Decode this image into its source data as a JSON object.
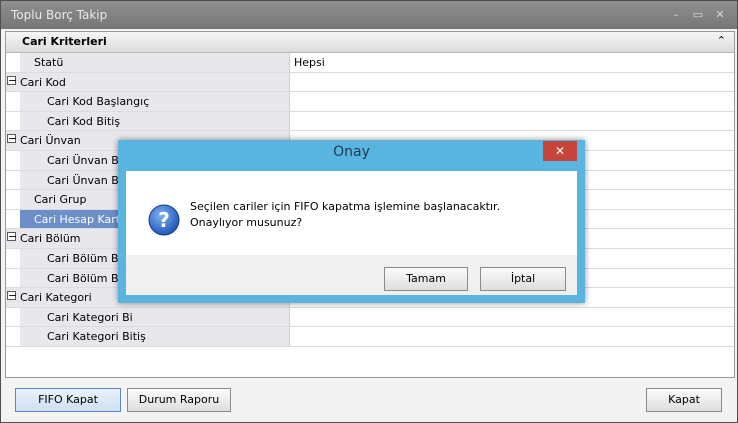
{
  "window": {
    "title": "Toplu Borç Takip",
    "controls": [
      "–",
      "▭",
      "✕"
    ]
  },
  "panel": {
    "title": "Cari Kriterleri",
    "collapse_icon": "chevron-double-up-icon"
  },
  "grid": {
    "rows": [
      {
        "label": "Statü",
        "value": "Hepsi",
        "kind": "item"
      },
      {
        "label": "Cari Kod",
        "value": "",
        "kind": "category"
      },
      {
        "label": "Cari Kod Başlangıç",
        "value": "",
        "kind": "sub"
      },
      {
        "label": "Cari Kod Bitiş",
        "value": "",
        "kind": "sub"
      },
      {
        "label": "Cari Ünvan",
        "value": "",
        "kind": "category"
      },
      {
        "label": "Cari Ünvan Baş",
        "value": "",
        "kind": "sub"
      },
      {
        "label": "Cari Ünvan Bitiş",
        "value": "",
        "kind": "sub"
      },
      {
        "label": "Cari Grup",
        "value": "",
        "kind": "item"
      },
      {
        "label": "Cari Hesap Kart T",
        "value": "",
        "kind": "item",
        "selected": true
      },
      {
        "label": "Cari Bölüm",
        "value": "",
        "kind": "category"
      },
      {
        "label": "Cari Bölüm Başl",
        "value": "",
        "kind": "sub"
      },
      {
        "label": "Cari Bölüm Bitiş",
        "value": "",
        "kind": "sub"
      },
      {
        "label": "Cari Kategori",
        "value": "",
        "kind": "category"
      },
      {
        "label": "Cari Kategori Bi",
        "value": "",
        "kind": "sub"
      },
      {
        "label": "Cari Kategori Bitiş",
        "value": "",
        "kind": "sub"
      }
    ]
  },
  "buttons": {
    "fifo": "FIFO Kapat",
    "durum": "Durum Raporu",
    "kapat": "Kapat"
  },
  "dialog": {
    "title": "Onay",
    "close": "✕",
    "message": "Seçilen cariler için FIFO kapatma işlemine başlanacaktır. Onaylıyor musunuz?",
    "ok": "Tamam",
    "cancel": "İptal",
    "icon": "question-icon",
    "accent": "#5ab4e0"
  }
}
